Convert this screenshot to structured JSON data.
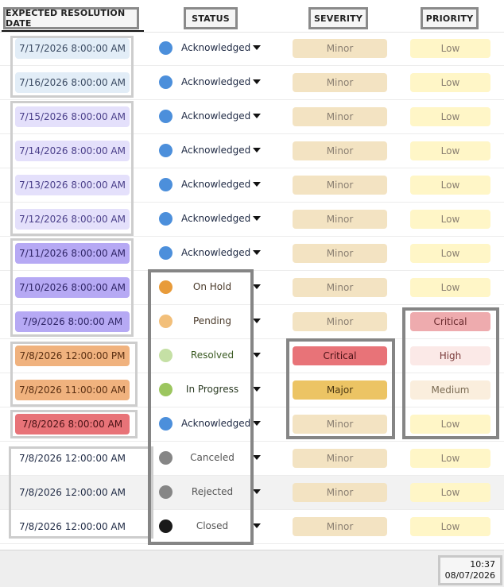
{
  "headers": {
    "date": "EXPECTED RESOLUTION DATE",
    "status": "STATUS",
    "severity": "SEVERITY",
    "priority": "PRIORITY"
  },
  "colors": {
    "date_light_blue": "#e2edf7",
    "date_lavender": "#e4e0fb",
    "date_purple": "#b6a9f4",
    "date_orange": "#f0b27e",
    "date_red": "#e87378",
    "sev_minor": "#f3e3c2",
    "sev_critical": "#e87378",
    "sev_major": "#ecc464",
    "pri_low": "#fff6c7",
    "pri_critical": "#eeabae",
    "pri_high": "#fbe9e7",
    "pri_medium": "#faeedd",
    "dot_blue": "#4c8fdb",
    "dot_orange": "#e89b3a",
    "dot_light_orange": "#f2bf7a",
    "dot_light_green": "#c5e0a5",
    "dot_green": "#9cc65f",
    "dot_gray": "#868686",
    "dot_black": "#1a1a1a"
  },
  "rows": [
    {
      "date": "7/17/2026 8:00:00 AM",
      "status": "Acknowledged",
      "severity": "Minor",
      "priority": "Low"
    },
    {
      "date": "7/16/2026 8:00:00 AM",
      "status": "Acknowledged",
      "severity": "Minor",
      "priority": "Low"
    },
    {
      "date": "7/15/2026 8:00:00 AM",
      "status": "Acknowledged",
      "severity": "Minor",
      "priority": "Low"
    },
    {
      "date": "7/14/2026 8:00:00 AM",
      "status": "Acknowledged",
      "severity": "Minor",
      "priority": "Low"
    },
    {
      "date": "7/13/2026 8:00:00 AM",
      "status": "Acknowledged",
      "severity": "Minor",
      "priority": "Low"
    },
    {
      "date": "7/12/2026 8:00:00 AM",
      "status": "Acknowledged",
      "severity": "Minor",
      "priority": "Low"
    },
    {
      "date": "7/11/2026 8:00:00 AM",
      "status": "Acknowledged",
      "severity": "Minor",
      "priority": "Low"
    },
    {
      "date": "7/10/2026 8:00:00 AM",
      "status": "On Hold",
      "severity": "Minor",
      "priority": "Low"
    },
    {
      "date": "7/9/2026 8:00:00 AM",
      "status": "Pending",
      "severity": "Minor",
      "priority": "Critical"
    },
    {
      "date": "7/8/2026 12:00:00 PM",
      "status": "Resolved",
      "severity": "Critical",
      "priority": "High"
    },
    {
      "date": "7/8/2026 11:00:00 AM",
      "status": "In Progress",
      "severity": "Major",
      "priority": "Medium"
    },
    {
      "date": "7/8/2026 8:00:00 AM",
      "status": "Acknowledged",
      "severity": "Minor",
      "priority": "Low"
    },
    {
      "date": "7/8/2026 12:00:00 AM",
      "status": "Canceled",
      "severity": "Minor",
      "priority": "Low"
    },
    {
      "date": "7/8/2026 12:00:00 AM",
      "status": "Rejected",
      "severity": "Minor",
      "priority": "Low"
    },
    {
      "date": "7/8/2026 12:00:00 AM",
      "status": "Closed",
      "severity": "Minor",
      "priority": "Low"
    }
  ],
  "taskbar": {
    "time": "10:37",
    "date": "08/07/2026"
  }
}
